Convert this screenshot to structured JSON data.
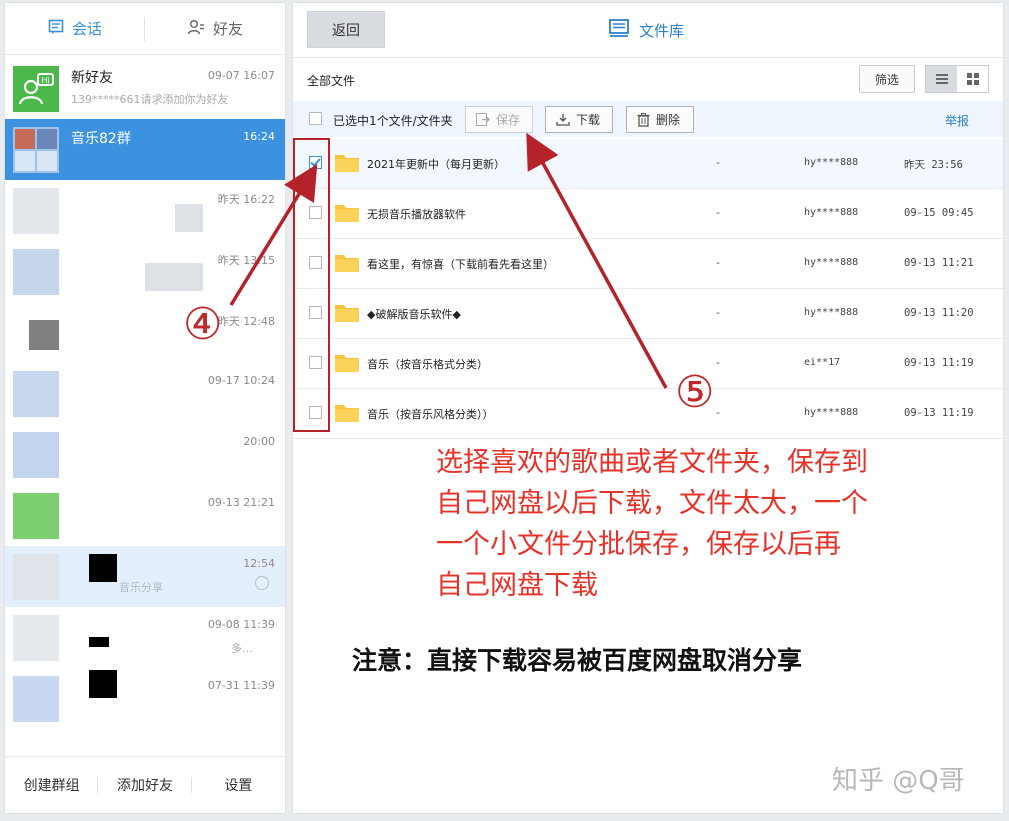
{
  "colors": {
    "accent": "#3c92df",
    "annotation": "#c0282b"
  },
  "tabs": {
    "conversations": "会话",
    "friends": "好友"
  },
  "conversations": [
    {
      "name": "新好友",
      "time": "09-07 16:07",
      "preview": "139*****661请求添加你为好友"
    },
    {
      "name": "音乐82群",
      "time": "16:24",
      "preview": ""
    },
    {
      "name": "",
      "time": "昨天 16:22",
      "preview": ""
    },
    {
      "name": "",
      "time": "昨天 13:15",
      "preview": ""
    },
    {
      "name": "",
      "time": "昨天 12:48",
      "preview": ""
    },
    {
      "name": "",
      "time": "09-17 10:24",
      "preview": ""
    },
    {
      "name": "",
      "time": "20:00",
      "preview": ""
    },
    {
      "name": "",
      "time": "09-13 21:21",
      "preview": ""
    },
    {
      "name": "",
      "time": "12:54",
      "preview": "音乐分享"
    },
    {
      "name": "",
      "time": "09-08 11:39",
      "preview": "多…"
    },
    {
      "name": "",
      "time": "07-31 11:39",
      "preview": ""
    }
  ],
  "bottom_bar": {
    "create_group": "创建群组",
    "add_friend": "添加好友",
    "settings": "设置"
  },
  "header": {
    "back": "返回",
    "title": "文件库"
  },
  "breadcrumb": "全部文件",
  "filter_label": "筛选",
  "toolbar": {
    "selected": "已选中1个文件/文件夹",
    "save": "保存",
    "download": "下载",
    "delete": "删除",
    "report": "举报"
  },
  "files": [
    {
      "name": "2021年更新中（每月更新）",
      "size": "-",
      "owner": "hy****888",
      "time": "昨天 23:56",
      "checked": true
    },
    {
      "name": "无损音乐播放器软件",
      "size": "-",
      "owner": "hy****888",
      "time": "09-15 09:45",
      "checked": false
    },
    {
      "name": "看这里，有惊喜（下载前看先看这里）",
      "size": "-",
      "owner": "hy****888",
      "time": "09-13 11:21",
      "checked": false
    },
    {
      "name": "◆破解版音乐软件◆",
      "size": "-",
      "owner": "hy****888",
      "time": "09-13 11:20",
      "checked": false
    },
    {
      "name": "音乐（按音乐格式分类）",
      "size": "-",
      "owner": "ei**17",
      "time": "09-13 11:19",
      "checked": false
    },
    {
      "name": "音乐（按音乐风格分类））",
      "size": "-",
      "owner": "hy****888",
      "time": "09-13 11:19",
      "checked": false
    }
  ],
  "annotations": {
    "marker4": "④",
    "marker5": "⑤",
    "note_lines": [
      "选择喜欢的歌曲或者文件夹，保存到",
      "自己网盘以后下载，文件太大，一个",
      "一个小文件分批保存，保存以后再",
      "自己网盘下载"
    ],
    "warning": "注意：直接下载容易被百度网盘取消分享",
    "watermark": "知乎 @Q哥"
  }
}
